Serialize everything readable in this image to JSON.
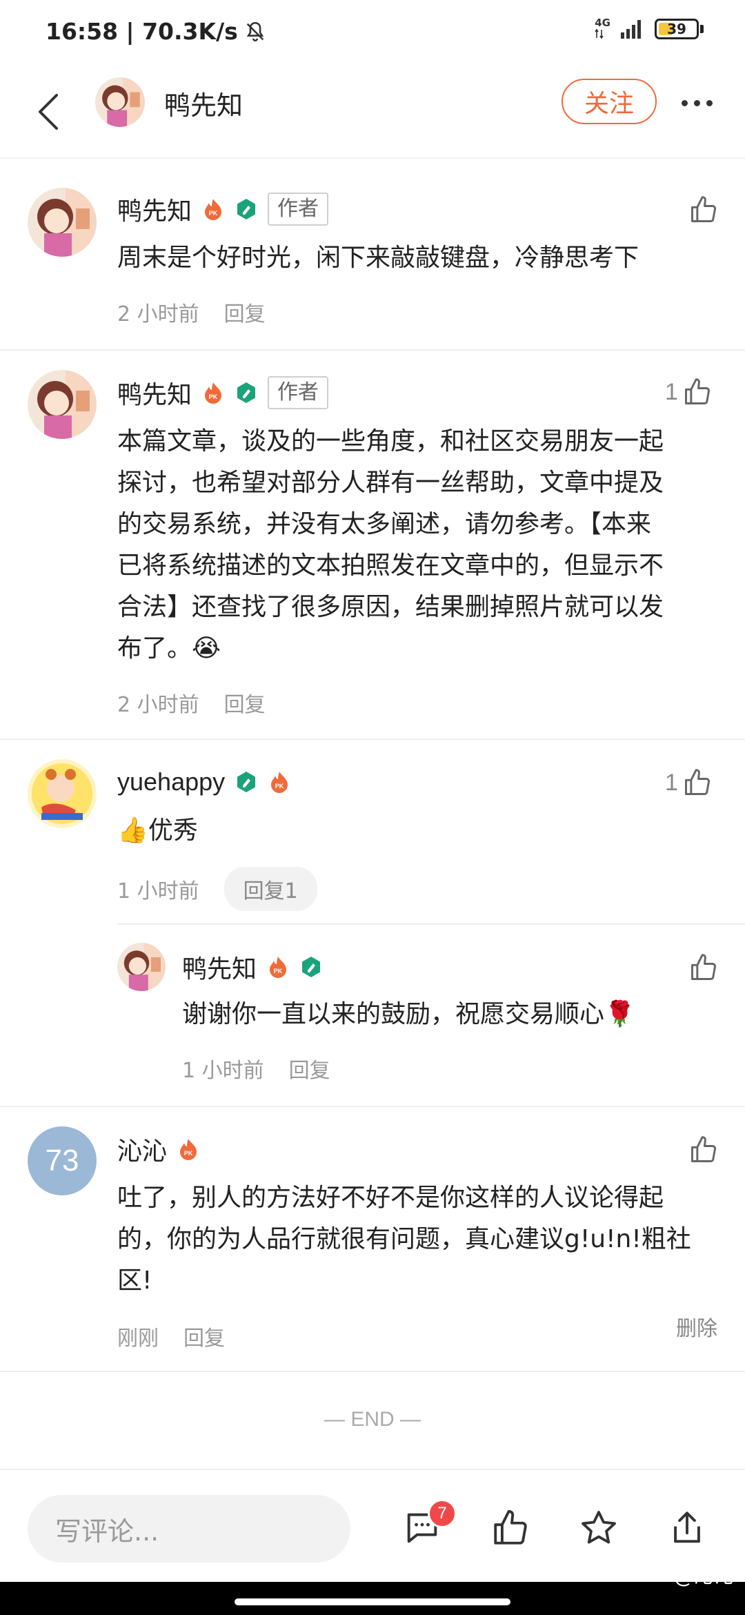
{
  "status": {
    "time_speed": "16:58 | 70.3K/s",
    "network": "4G",
    "battery": "39",
    "battery_level": 0.39,
    "battery_color": "#f5c542"
  },
  "nav": {
    "title": "鸭先知",
    "follow_label": "关注",
    "accent_color": "#f06a3a",
    "avatar_icon": "cartoon-girl-avatar",
    "back_icon": "chevron-left-icon",
    "more_icon": "more-dots-icon"
  },
  "comments": [
    {
      "name": "鸭先知",
      "author_tag": "作者",
      "badges": [
        "pk-fire-badge",
        "green-verified-badge"
      ],
      "content": "周末是个好时光，闲下来敲敲键盘，冷静思考下",
      "time": "2 小时前",
      "reply": "回复",
      "likes": ""
    },
    {
      "name": "鸭先知",
      "author_tag": "作者",
      "badges": [
        "pk-fire-badge",
        "green-verified-badge"
      ],
      "content_lines": [
        "本篇文章，谈及的一些角度，和社区交易朋友一起",
        "探讨，也希望对部分人群有一丝帮助，文章中提及",
        "的交易系统，并没有太多阐述，请勿参考。【本来",
        "已将系统描述的文本拍照发在文章中的，但显示不",
        "合法】还查找了很多原因，结果删掉照片就可以发",
        "布了。"
      ],
      "emoji": "😭",
      "time": "2 小时前",
      "reply": "回复",
      "likes": "1"
    },
    {
      "name": "yuehappy",
      "badges": [
        "green-verified-badge",
        "pk-fire-badge"
      ],
      "content_emoji": "👍",
      "content": "优秀",
      "time": "1 小时前",
      "reply": "回复1",
      "likes": "1",
      "sub_reply": {
        "name": "鸭先知",
        "badges": [
          "pk-fire-badge",
          "green-verified-badge"
        ],
        "content": "谢谢你一直以来的鼓励，祝愿交易顺心",
        "emoji": "🌹",
        "time": "1 小时前",
        "reply": "回复"
      }
    },
    {
      "name": "沁沁",
      "avatar_text": "73",
      "badges": [
        "pk-fire-badge"
      ],
      "content_lines": [
        "吐了，别人的方法好不好不是你这样的人议论得起",
        "的，你的为人品行就很有问题，真心建议g!u!n!粗社",
        "区!"
      ],
      "time": "刚刚",
      "reply": "回复",
      "delete": "删除"
    }
  ],
  "end_text": "— END —",
  "bottom": {
    "input_placeholder": "写评论...",
    "msg_count": "7",
    "icons": [
      "comment-bubble-icon",
      "thumbs-up-icon",
      "star-icon",
      "share-icon"
    ],
    "watermark": "@沁沁"
  }
}
